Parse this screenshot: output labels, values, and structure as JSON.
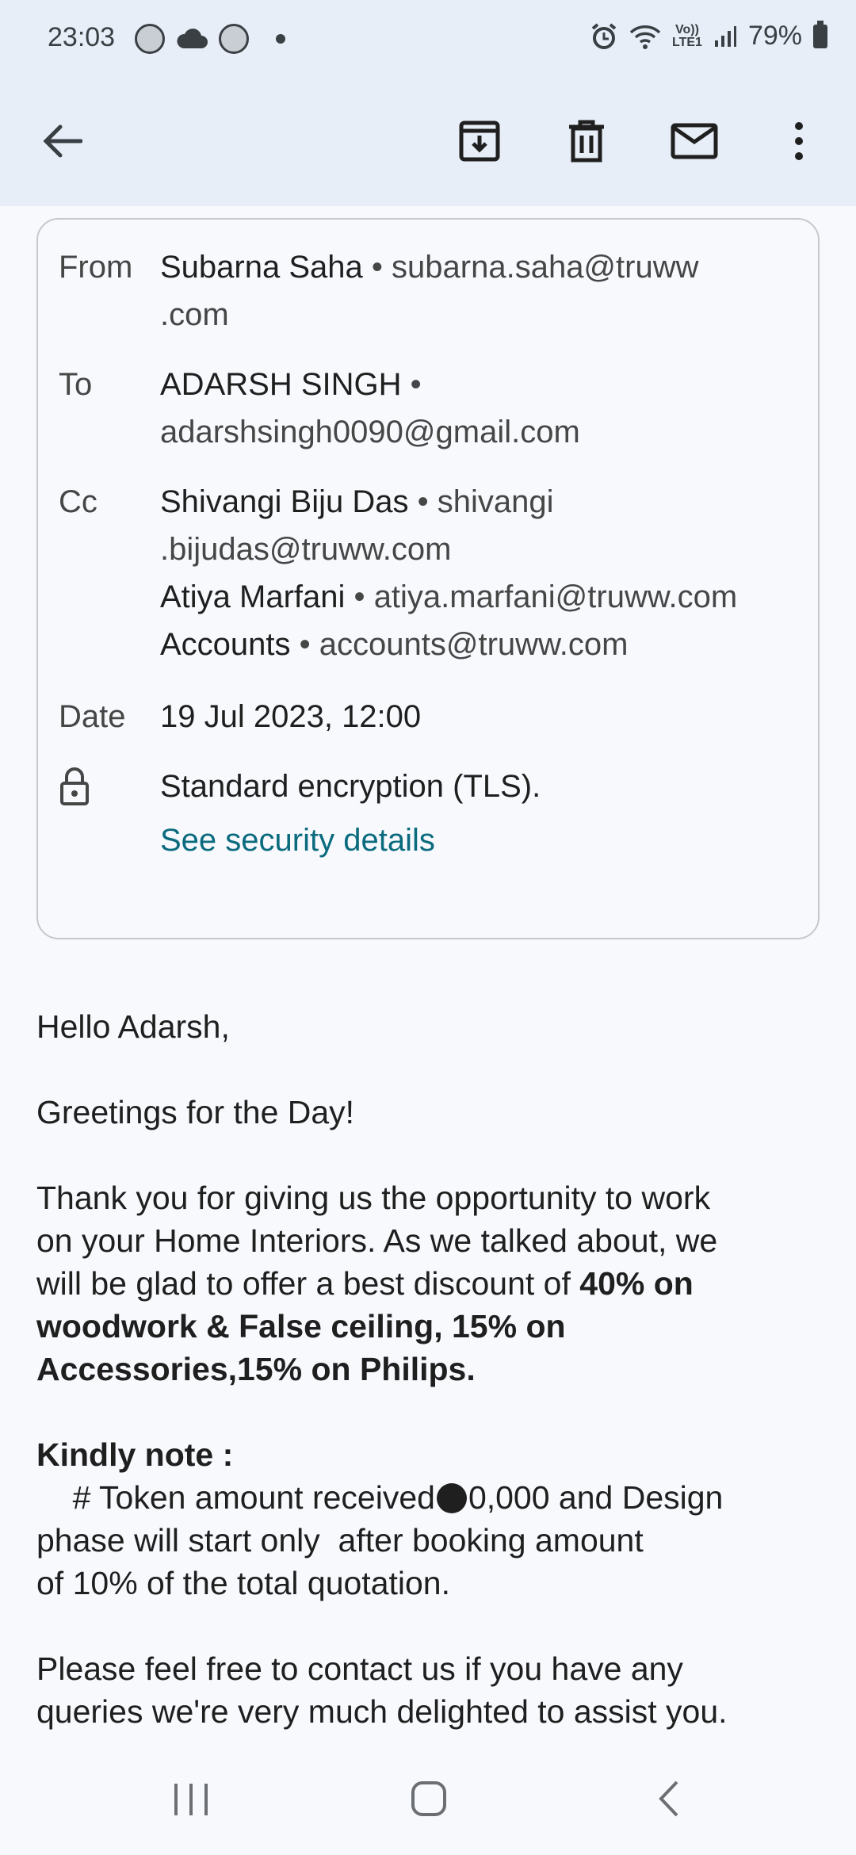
{
  "status_bar": {
    "time": "23:03",
    "battery": "79%",
    "network_small": "Vo))\nLTE1"
  },
  "app_bar": {
    "icons": [
      "back-arrow-icon",
      "archive-icon",
      "delete-icon",
      "mark-unread-icon",
      "more-vert-icon"
    ]
  },
  "details": {
    "from_label": "From",
    "from_name": "Subarna Saha",
    "from_email_1": "subarna.saha@truww",
    "from_email_2": ".com",
    "to_label": "To",
    "to_name": "ADARSH SINGH",
    "to_email": "adarshsingh0090@gmail.com",
    "cc_label": "Cc",
    "cc": [
      {
        "name": "Shivangi Biju Das",
        "email_1": "shivangi",
        "email_2": ".bijudas@truww.com"
      },
      {
        "name": "Atiya Marfani",
        "email": "atiya.marfani@truww.com"
      },
      {
        "name": "Accounts",
        "email": "accounts@truww.com"
      }
    ],
    "separator": "•",
    "date_label": "Date",
    "date_value": "19 Jul 2023, 12:00",
    "encryption_text": "Standard encryption (TLS).",
    "security_link": "See security details"
  },
  "body": {
    "greeting": "Hello Adarsh,",
    "line2": "Greetings for the Day!",
    "para1_l1": "Thank you for giving us the opportunity to work",
    "para1_l2": "on your Home Interiors. As we talked about, we",
    "para1_l3a": "will be glad to offer a best discount of ",
    "para1_l3b": "40% on",
    "para1_l4": "woodwork & False ceiling, 15% on",
    "para1_l5": "Accessories,15% on Philips.",
    "note_heading": "Kindly note :",
    "note_l1a": "    # Token amount received",
    "note_l1b": "0,000 and Design",
    "note_l2": "phase will start only  after booking amount",
    "note_l3": "of 10% of the total quotation.",
    "para3_l1": "Please feel free to contact us if you have any",
    "para3_l2": "queries we're very much delighted to assist you."
  },
  "nav_bar": {
    "icons": [
      "recents-icon",
      "home-icon",
      "back-icon"
    ]
  },
  "colors": {
    "header_bg": "#e7eef7",
    "page_bg": "#f7f9fd",
    "link": "#0b6b7e"
  }
}
